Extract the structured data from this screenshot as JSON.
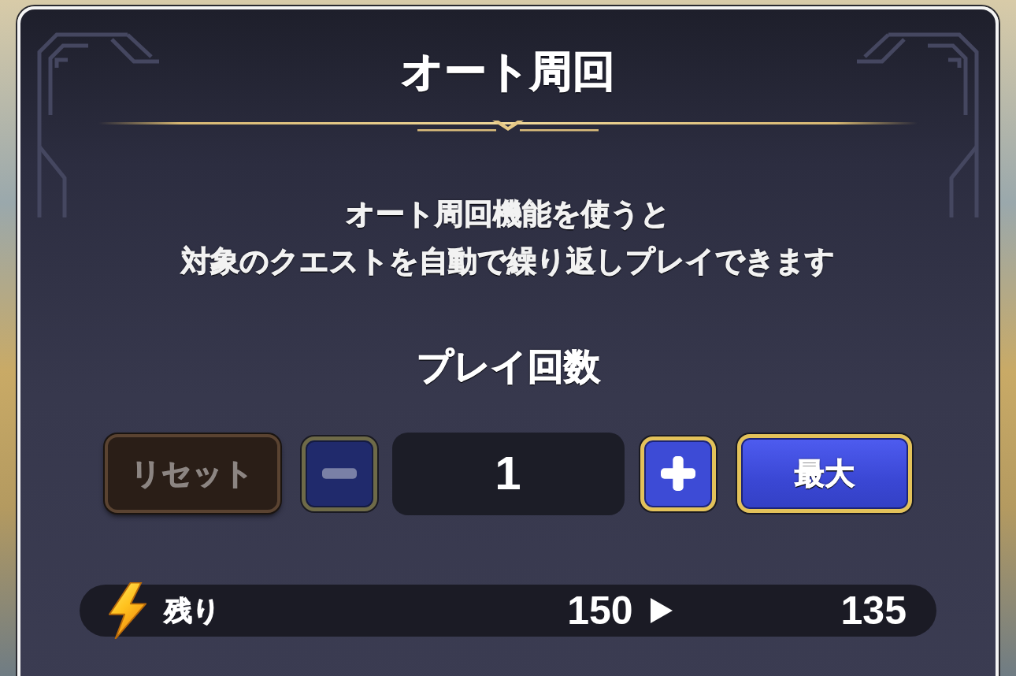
{
  "dialog": {
    "title": "オート周回",
    "description_lines": [
      "オート周回機能を使うと",
      "対象のクエストを自動で繰り返しプレイできます"
    ],
    "play_count": {
      "label": "プレイ回数",
      "reset_button": {
        "label": "リセット",
        "disabled": true
      },
      "decrement_button": {
        "disabled": true
      },
      "value": "1",
      "increment_button": {
        "disabled": false
      },
      "max_button": {
        "label": "最大",
        "disabled": false
      }
    },
    "stamina": {
      "label": "残り",
      "current": "150",
      "after": "135"
    }
  }
}
